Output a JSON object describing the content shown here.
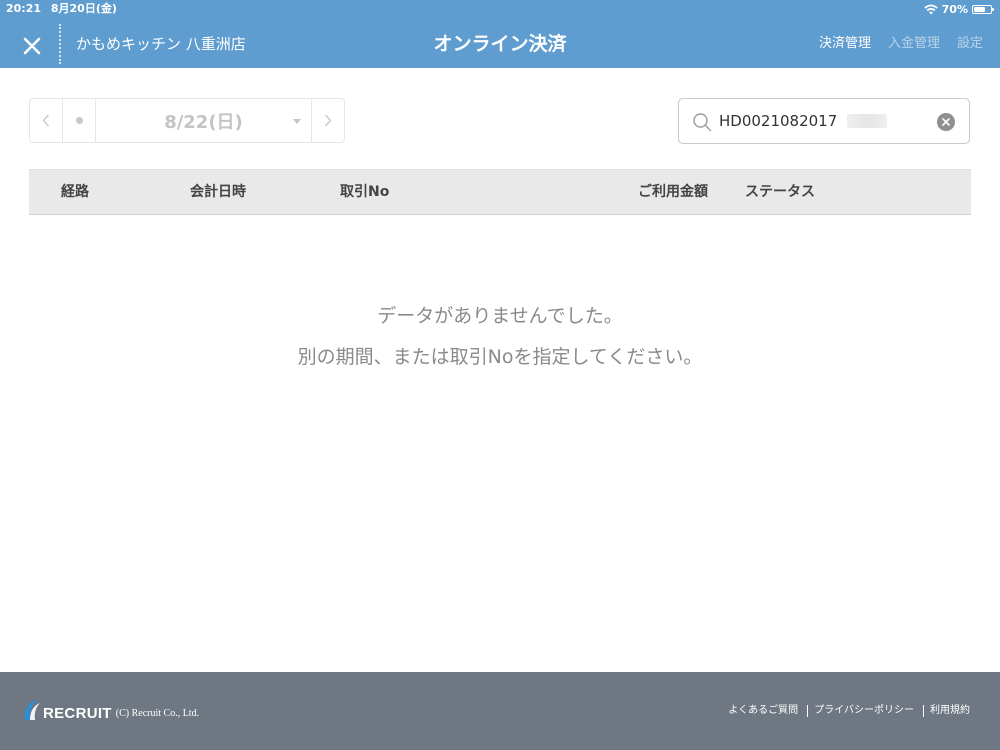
{
  "status_bar": {
    "time": "20:21",
    "date": "8月20日(金)",
    "battery": "70%",
    "battery_level": 0.7
  },
  "header": {
    "shop_name": "かもめキッチン 八重洲店",
    "title": "オンライン決済",
    "nav": [
      {
        "label": "決済管理",
        "active": true
      },
      {
        "label": "入金管理",
        "active": false
      },
      {
        "label": "設定",
        "active": false
      }
    ]
  },
  "date_picker": {
    "date": "8/22(日)"
  },
  "search": {
    "value": "HD0021082017",
    "placeholder": ""
  },
  "table": {
    "columns": [
      "経路",
      "会計日時",
      "取引No",
      "ご利用金額",
      "ステータス"
    ],
    "rows": []
  },
  "empty_state": {
    "line1": "データがありませんでした。",
    "line2": "別の期間、または取引Noを指定してください。"
  },
  "footer": {
    "logo_text": "RECRUIT",
    "copyright": "(C) Recruit Co., Ltd.",
    "links": [
      "よくあるご質問",
      "プライバシーポリシー",
      "利用規約"
    ]
  },
  "colors": {
    "header_bg": "#5f9dd0",
    "footer_bg": "#6f7882",
    "table_header_bg": "#e9e9e9",
    "logo_blue": "#2a8fd8"
  }
}
